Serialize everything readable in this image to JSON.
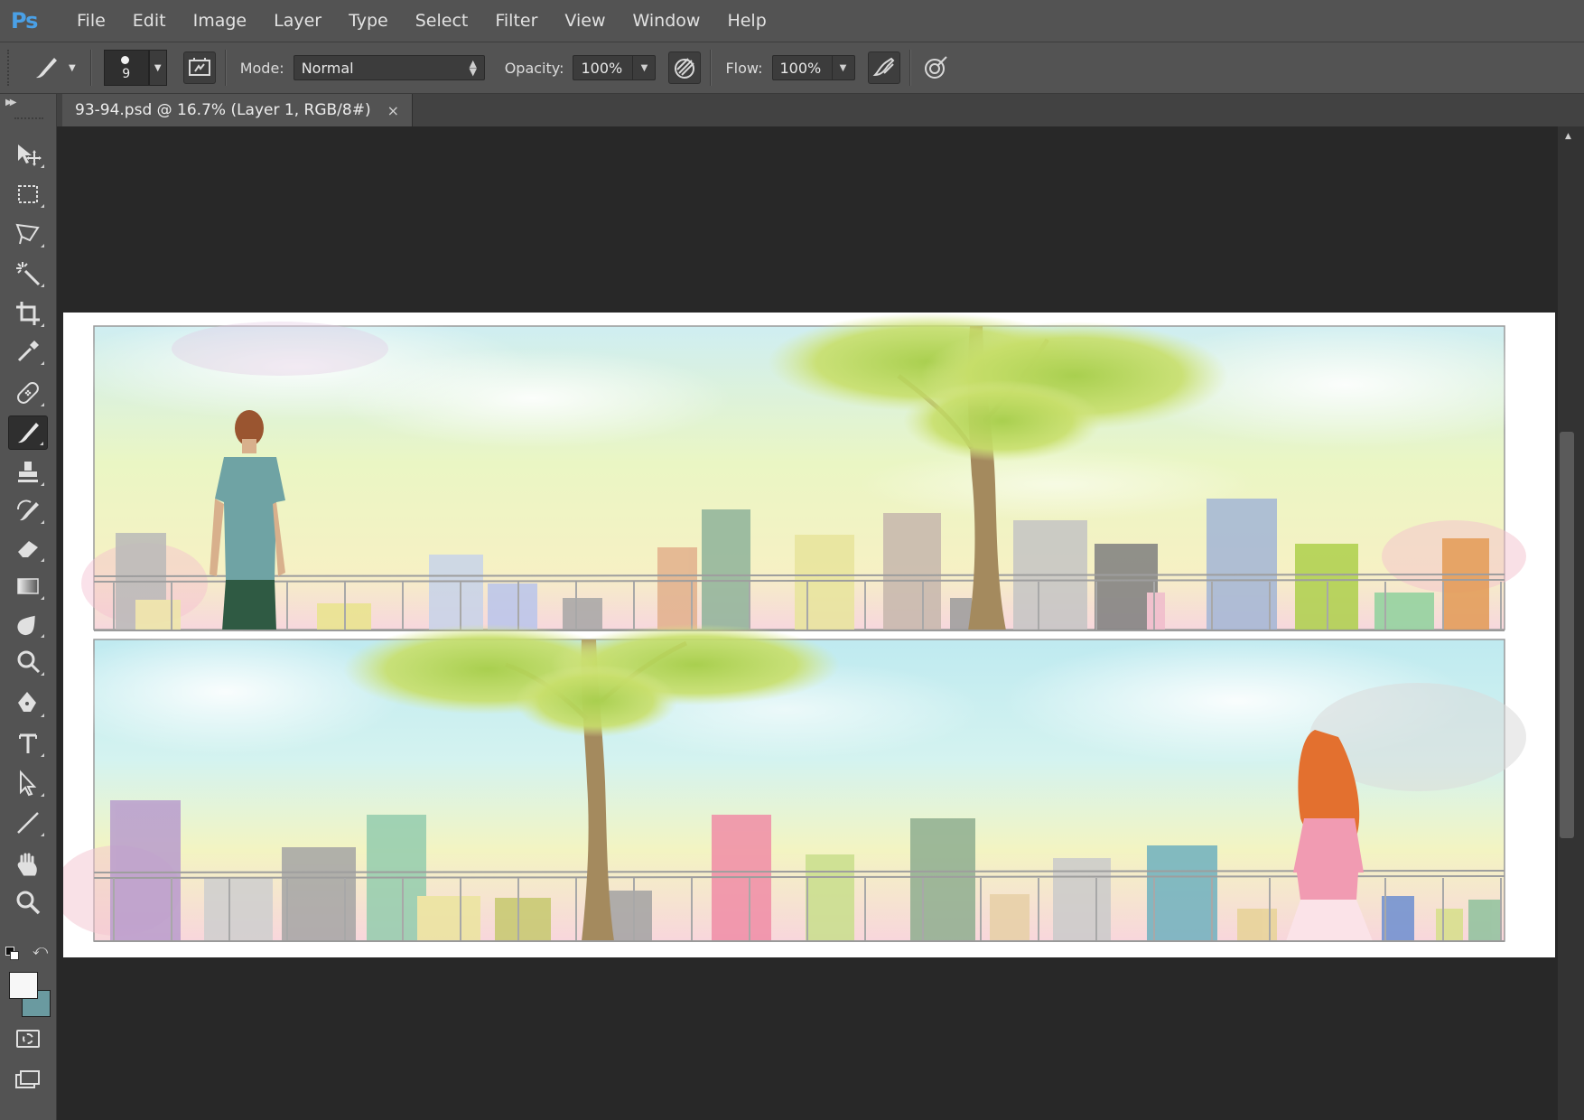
{
  "app": {
    "logo": "Ps"
  },
  "menu": [
    "File",
    "Edit",
    "Image",
    "Layer",
    "Type",
    "Select",
    "Filter",
    "View",
    "Window",
    "Help"
  ],
  "options": {
    "brush_size": "9",
    "mode_label": "Mode:",
    "mode_value": "Normal",
    "opacity_label": "Opacity:",
    "opacity_value": "100%",
    "flow_label": "Flow:",
    "flow_value": "100%"
  },
  "document": {
    "tab_title": "93-94.psd @ 16.7% (Layer 1, RGB/8#)",
    "close_glyph": "×"
  },
  "tools": [
    {
      "name": "move-tool",
      "icon": "move-icon"
    },
    {
      "name": "rectangular-marquee-tool",
      "icon": "marquee-icon"
    },
    {
      "name": "polygonal-lasso-tool",
      "icon": "lasso-icon"
    },
    {
      "name": "magic-wand-tool",
      "icon": "magic-wand-icon"
    },
    {
      "name": "crop-tool",
      "icon": "crop-icon"
    },
    {
      "name": "eyedropper-tool",
      "icon": "eyedropper-icon"
    },
    {
      "name": "healing-brush-tool",
      "icon": "bandage-icon"
    },
    {
      "name": "brush-tool",
      "icon": "brush-icon",
      "active": true
    },
    {
      "name": "clone-stamp-tool",
      "icon": "stamp-icon"
    },
    {
      "name": "history-brush-tool",
      "icon": "history-brush-icon"
    },
    {
      "name": "eraser-tool",
      "icon": "eraser-icon"
    },
    {
      "name": "gradient-tool",
      "icon": "gradient-icon"
    },
    {
      "name": "blur-tool",
      "icon": "blur-icon"
    },
    {
      "name": "dodge-tool",
      "icon": "dodge-icon"
    },
    {
      "name": "pen-tool",
      "icon": "pen-icon"
    },
    {
      "name": "type-tool",
      "icon": "type-icon"
    },
    {
      "name": "path-selection-tool",
      "icon": "arrow-icon"
    },
    {
      "name": "line-tool",
      "icon": "line-icon"
    },
    {
      "name": "hand-tool",
      "icon": "hand-icon"
    },
    {
      "name": "zoom-tool",
      "icon": "zoom-icon"
    }
  ],
  "colors": {
    "foreground": "#f7f7f7",
    "background": "#6a9aa0",
    "accent": "#4aa0e6"
  }
}
